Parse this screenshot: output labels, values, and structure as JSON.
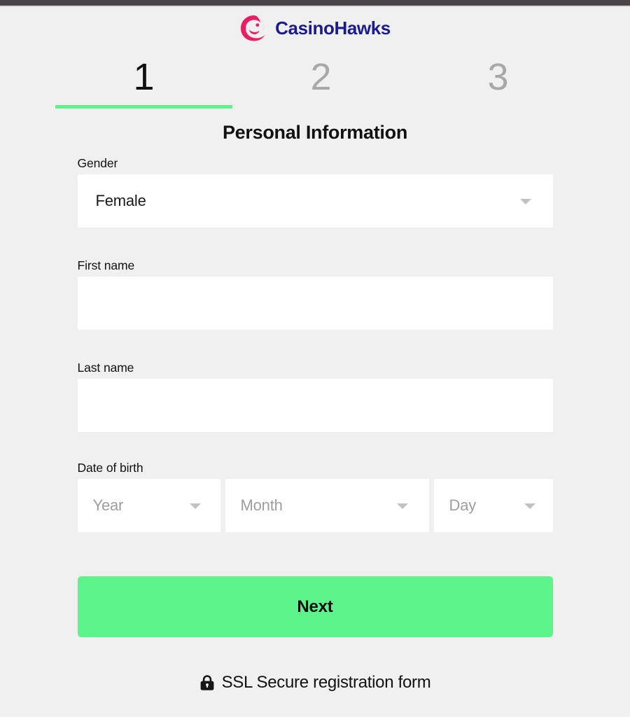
{
  "brand": {
    "name": "CasinoHawks",
    "logo_icon": "hawk-logo-icon",
    "logo_color": "#e81f64",
    "name_color": "#1b1b8f"
  },
  "stepper": {
    "active_index": 1,
    "accent_color": "#5df58b",
    "inactive_color": "#a8a8a8",
    "steps": [
      {
        "label": "1",
        "active": true
      },
      {
        "label": "2",
        "active": false
      },
      {
        "label": "3",
        "active": false
      }
    ]
  },
  "form": {
    "title": "Personal Information",
    "gender": {
      "label": "Gender",
      "value": "Female",
      "placeholder": "Gender",
      "caret_icon": "chevron-down-icon"
    },
    "first_name": {
      "label": "First name",
      "value": "",
      "placeholder": ""
    },
    "last_name": {
      "label": "Last name",
      "value": "",
      "placeholder": ""
    },
    "date_of_birth": {
      "label": "Date of birth",
      "year": {
        "value": "",
        "placeholder": "Year",
        "caret_icon": "chevron-down-icon"
      },
      "month": {
        "value": "",
        "placeholder": "Month",
        "caret_icon": "chevron-down-icon"
      },
      "day": {
        "value": "",
        "placeholder": "Day",
        "caret_icon": "chevron-down-icon"
      }
    },
    "submit": {
      "label": "Next",
      "background": "#5df58b",
      "text_color": "#0d0d0d"
    }
  },
  "footer": {
    "lock_icon": "lock-icon",
    "text": "SSL Secure registration form"
  }
}
